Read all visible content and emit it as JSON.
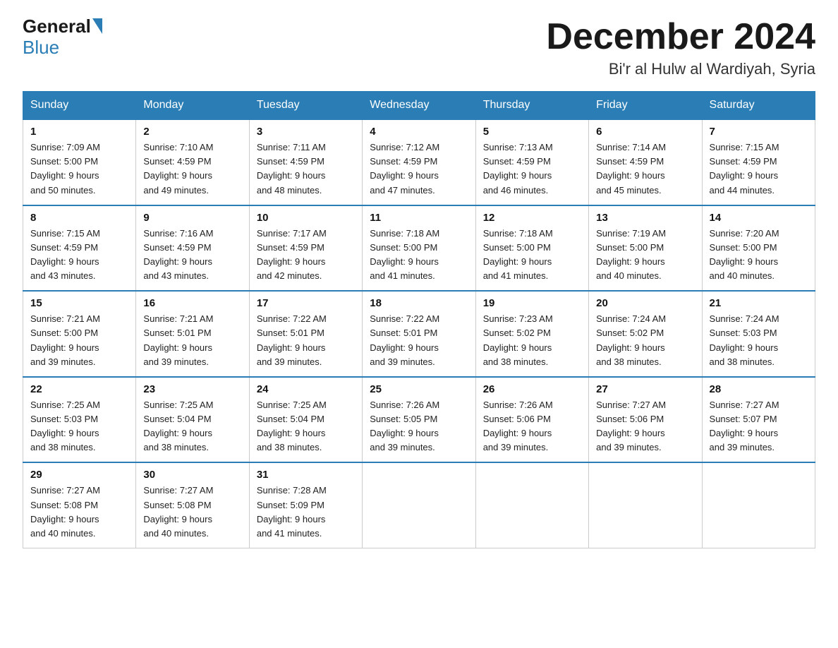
{
  "header": {
    "logo_general": "General",
    "logo_blue": "Blue",
    "month_title": "December 2024",
    "location": "Bi'r al Hulw al Wardiyah, Syria"
  },
  "days_of_week": [
    "Sunday",
    "Monday",
    "Tuesday",
    "Wednesday",
    "Thursday",
    "Friday",
    "Saturday"
  ],
  "weeks": [
    [
      {
        "day": "1",
        "sunrise": "7:09 AM",
        "sunset": "5:00 PM",
        "daylight": "9 hours and 50 minutes."
      },
      {
        "day": "2",
        "sunrise": "7:10 AM",
        "sunset": "4:59 PM",
        "daylight": "9 hours and 49 minutes."
      },
      {
        "day": "3",
        "sunrise": "7:11 AM",
        "sunset": "4:59 PM",
        "daylight": "9 hours and 48 minutes."
      },
      {
        "day": "4",
        "sunrise": "7:12 AM",
        "sunset": "4:59 PM",
        "daylight": "9 hours and 47 minutes."
      },
      {
        "day": "5",
        "sunrise": "7:13 AM",
        "sunset": "4:59 PM",
        "daylight": "9 hours and 46 minutes."
      },
      {
        "day": "6",
        "sunrise": "7:14 AM",
        "sunset": "4:59 PM",
        "daylight": "9 hours and 45 minutes."
      },
      {
        "day": "7",
        "sunrise": "7:15 AM",
        "sunset": "4:59 PM",
        "daylight": "9 hours and 44 minutes."
      }
    ],
    [
      {
        "day": "8",
        "sunrise": "7:15 AM",
        "sunset": "4:59 PM",
        "daylight": "9 hours and 43 minutes."
      },
      {
        "day": "9",
        "sunrise": "7:16 AM",
        "sunset": "4:59 PM",
        "daylight": "9 hours and 43 minutes."
      },
      {
        "day": "10",
        "sunrise": "7:17 AM",
        "sunset": "4:59 PM",
        "daylight": "9 hours and 42 minutes."
      },
      {
        "day": "11",
        "sunrise": "7:18 AM",
        "sunset": "5:00 PM",
        "daylight": "9 hours and 41 minutes."
      },
      {
        "day": "12",
        "sunrise": "7:18 AM",
        "sunset": "5:00 PM",
        "daylight": "9 hours and 41 minutes."
      },
      {
        "day": "13",
        "sunrise": "7:19 AM",
        "sunset": "5:00 PM",
        "daylight": "9 hours and 40 minutes."
      },
      {
        "day": "14",
        "sunrise": "7:20 AM",
        "sunset": "5:00 PM",
        "daylight": "9 hours and 40 minutes."
      }
    ],
    [
      {
        "day": "15",
        "sunrise": "7:21 AM",
        "sunset": "5:00 PM",
        "daylight": "9 hours and 39 minutes."
      },
      {
        "day": "16",
        "sunrise": "7:21 AM",
        "sunset": "5:01 PM",
        "daylight": "9 hours and 39 minutes."
      },
      {
        "day": "17",
        "sunrise": "7:22 AM",
        "sunset": "5:01 PM",
        "daylight": "9 hours and 39 minutes."
      },
      {
        "day": "18",
        "sunrise": "7:22 AM",
        "sunset": "5:01 PM",
        "daylight": "9 hours and 39 minutes."
      },
      {
        "day": "19",
        "sunrise": "7:23 AM",
        "sunset": "5:02 PM",
        "daylight": "9 hours and 38 minutes."
      },
      {
        "day": "20",
        "sunrise": "7:24 AM",
        "sunset": "5:02 PM",
        "daylight": "9 hours and 38 minutes."
      },
      {
        "day": "21",
        "sunrise": "7:24 AM",
        "sunset": "5:03 PM",
        "daylight": "9 hours and 38 minutes."
      }
    ],
    [
      {
        "day": "22",
        "sunrise": "7:25 AM",
        "sunset": "5:03 PM",
        "daylight": "9 hours and 38 minutes."
      },
      {
        "day": "23",
        "sunrise": "7:25 AM",
        "sunset": "5:04 PM",
        "daylight": "9 hours and 38 minutes."
      },
      {
        "day": "24",
        "sunrise": "7:25 AM",
        "sunset": "5:04 PM",
        "daylight": "9 hours and 38 minutes."
      },
      {
        "day": "25",
        "sunrise": "7:26 AM",
        "sunset": "5:05 PM",
        "daylight": "9 hours and 39 minutes."
      },
      {
        "day": "26",
        "sunrise": "7:26 AM",
        "sunset": "5:06 PM",
        "daylight": "9 hours and 39 minutes."
      },
      {
        "day": "27",
        "sunrise": "7:27 AM",
        "sunset": "5:06 PM",
        "daylight": "9 hours and 39 minutes."
      },
      {
        "day": "28",
        "sunrise": "7:27 AM",
        "sunset": "5:07 PM",
        "daylight": "9 hours and 39 minutes."
      }
    ],
    [
      {
        "day": "29",
        "sunrise": "7:27 AM",
        "sunset": "5:08 PM",
        "daylight": "9 hours and 40 minutes."
      },
      {
        "day": "30",
        "sunrise": "7:27 AM",
        "sunset": "5:08 PM",
        "daylight": "9 hours and 40 minutes."
      },
      {
        "day": "31",
        "sunrise": "7:28 AM",
        "sunset": "5:09 PM",
        "daylight": "9 hours and 41 minutes."
      },
      null,
      null,
      null,
      null
    ]
  ],
  "labels": {
    "sunrise": "Sunrise:",
    "sunset": "Sunset:",
    "daylight": "Daylight:"
  }
}
